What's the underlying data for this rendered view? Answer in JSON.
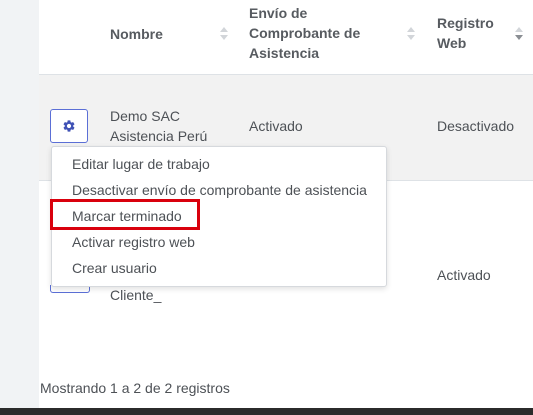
{
  "table": {
    "headers": {
      "nombre": "Nombre",
      "envio": [
        "Envío de",
        "Comprobante de",
        "Asistencia"
      ],
      "registro": [
        "Registro",
        "Web"
      ]
    },
    "rows": [
      {
        "nombre": [
          "Demo SAC",
          "Asistencia Perú"
        ],
        "envio": "Activado",
        "registro": "Desactivado"
      },
      {
        "nombre": [
          "Cliente_"
        ],
        "envio": "",
        "registro": "Activado"
      }
    ]
  },
  "dropdown": {
    "items": [
      "Editar lugar de trabajo",
      "Desactivar envío de comprobante de asistencia",
      "Marcar terminado",
      "Activar registro web",
      "Crear usuario"
    ],
    "highlighted_item": "Marcar terminado"
  },
  "footer": {
    "info": "Mostrando 1 a 2 de 2 registros"
  },
  "icons": {
    "actions_button": "gear-icon",
    "sort_neutral": "sort-both-icon",
    "sort_desc": "sort-desc-icon"
  },
  "colors": {
    "accent": "#5b6fd6",
    "highlight_border": "#d9000d",
    "row_alt_bg": "#f2f2f2"
  }
}
